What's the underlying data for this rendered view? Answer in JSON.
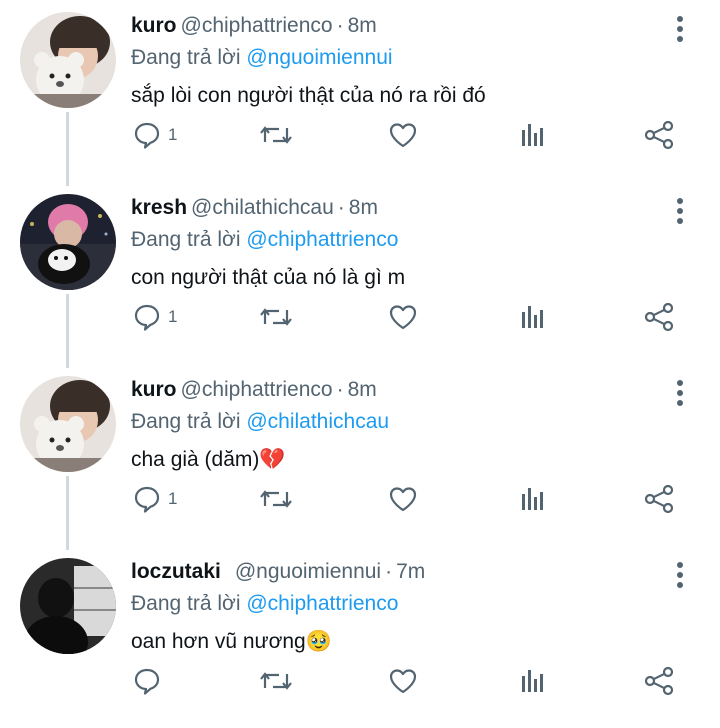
{
  "tweets": [
    {
      "name": "kuro",
      "handle": "@chiphattrienco",
      "time": "8m",
      "reply_prefix": "Đang trả lời",
      "reply_to": "@nguoimiennui",
      "text": "sắp lòi con người thật của nó ra rồi đó",
      "reply_count": "1",
      "avatar": "person-with-white-bear-plush"
    },
    {
      "name": "kresh",
      "handle": "@chilathichcau",
      "time": "8m",
      "reply_prefix": "Đang trả lời",
      "reply_to": "@chiphattrienco",
      "text": "con người thật của nó là gì m",
      "reply_count": "1",
      "avatar": "pink-hair-person-with-dog-city-night"
    },
    {
      "name": "kuro",
      "handle": "@chiphattrienco",
      "time": "8m",
      "reply_prefix": "Đang trả lời",
      "reply_to": "@chilathichcau",
      "text": "cha già (dăm)💔",
      "reply_count": "1",
      "avatar": "person-with-white-bear-plush"
    },
    {
      "name": "loczutaki",
      "handle": "@nguoimiennui",
      "time": "7m",
      "reply_prefix": "Đang trả lời",
      "reply_to": "@chiphattrienco",
      "text": "oan hơn vũ nương🥹",
      "reply_count": "",
      "avatar": "dark-silhouette-by-window"
    }
  ],
  "colors": {
    "text": "#0f1419",
    "muted": "#536471",
    "link": "#1d9bf0",
    "thread_line": "#cfd9de"
  }
}
